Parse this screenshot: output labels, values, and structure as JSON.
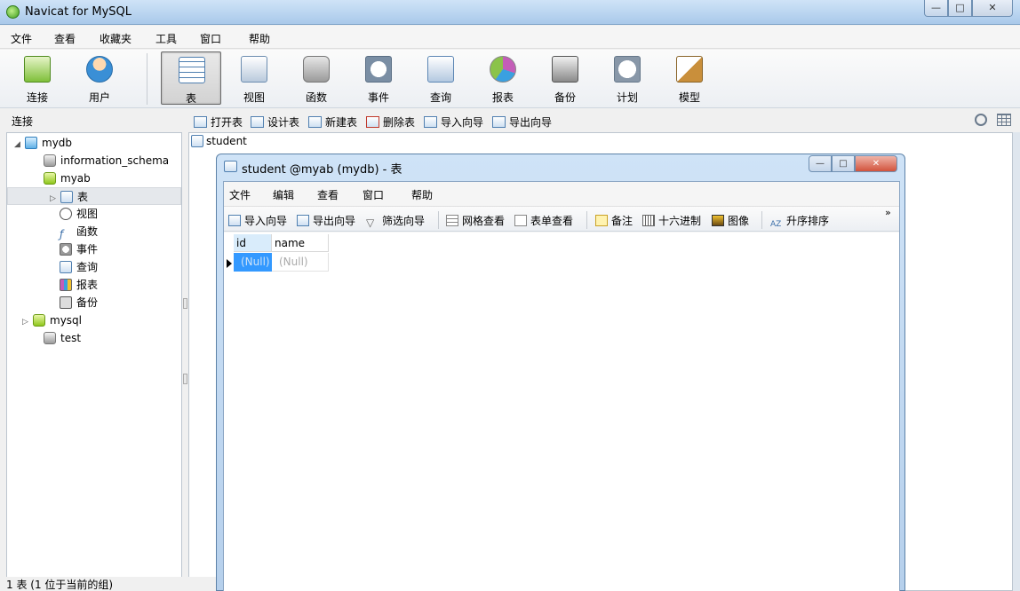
{
  "window": {
    "title": "Navicat for MySQL",
    "buttons": {
      "minimize": "—",
      "maximize": "□",
      "close": "✕"
    }
  },
  "menu": [
    "文件",
    "查看",
    "收藏夹",
    "工具",
    "窗口",
    "帮助"
  ],
  "toolbar": [
    {
      "label": "连接",
      "icon": "connection-icon",
      "color": "#7fbf3a"
    },
    {
      "label": "用户",
      "icon": "user-icon",
      "color": "#3a8fd6"
    },
    {
      "label": "表",
      "icon": "table-icon",
      "color": "#4f7fb0",
      "active": true
    },
    {
      "label": "视图",
      "icon": "view-icon",
      "color": "#6c8db0"
    },
    {
      "label": "函数",
      "icon": "function-icon",
      "color": "#e08a1e"
    },
    {
      "label": "事件",
      "icon": "event-icon",
      "color": "#7a8ea4"
    },
    {
      "label": "查询",
      "icon": "query-icon",
      "color": "#5c86b4"
    },
    {
      "label": "报表",
      "icon": "report-icon",
      "color": "#c45db8"
    },
    {
      "label": "备份",
      "icon": "backup-icon",
      "color": "#6b6b6b"
    },
    {
      "label": "计划",
      "icon": "schedule-icon",
      "color": "#8897a8"
    },
    {
      "label": "模型",
      "icon": "model-icon",
      "color": "#c98f3b"
    }
  ],
  "panel": {
    "connection_label": "连接"
  },
  "objbar": [
    "打开表",
    "设计表",
    "新建表",
    "删除表",
    "导入向导",
    "导出向导"
  ],
  "tree": {
    "root": "mydb",
    "items": [
      "information_schema",
      "myab",
      "表",
      "视图",
      "函数",
      "事件",
      "查询",
      "报表",
      "备份",
      "mysql",
      "test"
    ]
  },
  "objects": [
    "student"
  ],
  "status": "1 表 (1 位于当前的组)",
  "child": {
    "title": "student @myab (mydb) - 表",
    "buttons": {
      "minimize": "—",
      "maximize": "□",
      "close": "✕"
    },
    "menu": [
      "文件",
      "编辑",
      "查看",
      "窗口",
      "帮助"
    ],
    "toolbar": [
      "导入向导",
      "导出向导",
      "筛选向导",
      "网格查看",
      "表单查看",
      "备注",
      "十六进制",
      "图像",
      "升序排序"
    ],
    "more": "»",
    "columns": [
      "id",
      "name"
    ],
    "rows": [
      [
        "(Null)",
        "(Null)"
      ]
    ]
  }
}
